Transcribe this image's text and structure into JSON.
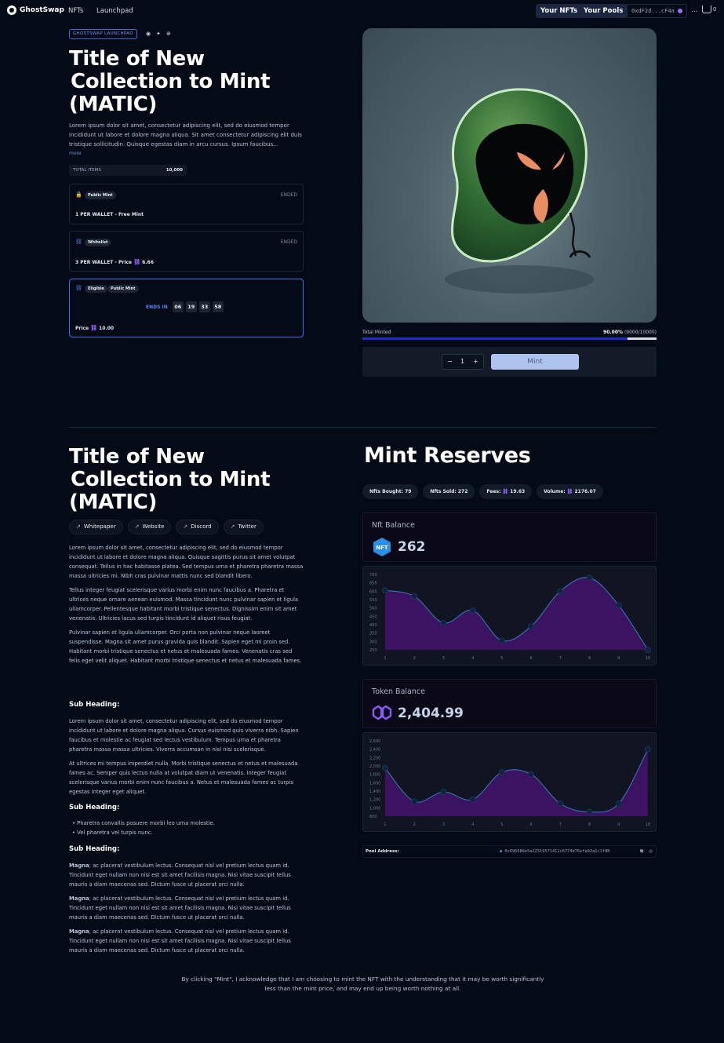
{
  "nav": {
    "brand": "GhostSwap",
    "links": [
      "NFTs",
      "Launchpad"
    ],
    "your_nfts": "Your NFTs",
    "your_pools": "Your Pools",
    "wallet": "0xdF2d...cF4a",
    "more": "...",
    "cart_count": "0"
  },
  "hero": {
    "badge": "GHOSTSWAP LAUNCHPAD",
    "title_lines": [
      "Title of New",
      "Collection to Mint",
      "(MATIC)"
    ],
    "description": "Lorem ipsum dolor sit amet, consectetur adipiscing elit, sed do eiusmod tempor incididunt ut labore et dolore magna aliqua. Sit amet consectetur adipiscing elit duis tristique sollicitudin. Quisque egestas diam in arcu cursus. Ipsum faucibus...",
    "more": "more",
    "total_items_label": "TOTAL ITEMS",
    "total_items_value": "10,000"
  },
  "phases": [
    {
      "tag": "Public Mint",
      "status": "ENDED",
      "text": "1 PER WALLET - Free Mint"
    },
    {
      "tag": "Whitelist",
      "status": "ENDED",
      "text": "3 PER WALLET - Price",
      "price": "6.66"
    },
    {
      "tags": [
        "Eligible",
        "Public Mint"
      ],
      "ends_label": "ENDS IN",
      "timer": [
        "06",
        "19",
        "33",
        "58"
      ],
      "price_label": "Price",
      "price": "10.00"
    }
  ],
  "mint": {
    "total_minted_label": "Total Minted",
    "pct": "90.00%",
    "count": "(9000/10000)",
    "progress": 0.9,
    "minus": "−",
    "qty": "1",
    "plus": "+",
    "button": "Mint"
  },
  "details": {
    "title_lines": [
      "Title of New",
      "Collection to Mint",
      "(MATIC)"
    ],
    "links": [
      "Whitepaper",
      "Website",
      "Discord",
      "Twitter"
    ],
    "p1": "Lorem ipsum dolor sit amet, consectetur adipiscing elit, sed do eiusmod tempor incididunt ut labore et dolore magna aliqua. Quisque sagittis purus sit amet volutpat consequat. Tellus in hac habitasse platea. Sed tempus urna et pharetra pharetra massa massa ultricies mi. Nibh cras pulvinar mattis nunc sed blandit libero.",
    "p2": "Tellus integer feugiat scelerisque varius morbi enim nunc faucibus a. Pharetra et ultrices neque ornare aenean euismod. Massa tincidunt nunc pulvinar sapien et ligula ullamcorper. Pellentesque habitant morbi tristique senectus. Dignissim enim sit amet venenatis. Ultricies lacus sed turpis tincidunt id aliquet risus feugiat.",
    "p3": "Pulvinar sapien et ligula ullamcorper. Orci porta non pulvinar neque laoreet suspendisse. Magna sit amet purus gravida quis blandit. Sapien eget mi proin sed. Habitant morbi tristique senectus et netus et malesuada fames. Venenatis cras sed felis eget velit aliquet. Habitant morbi tristique senectus et netus et malesuada fames.",
    "sub1": "Sub Heading:",
    "p4": "Lorem ipsum dolor sit amet, consectetur adipiscing elit, sed do eiusmod tempor incididunt ut labore et dolore magna aliqua. Cursus euismod quis viverra nibh. Sapien faucibus et molestie ac feugiat sed lectus vestibulum. Tempus urna et pharetra pharetra massa massa ultricies. Viverra accumsan in nisl nisi scelerisque.",
    "p5": "At ultrices mi tempus imperdiet nulla. Morbi tristique senectus et netus et malesuada fames ac. Semper quis lectus nulla at volutpat diam ut venenatis. Integer feugiat scelerisque varius morbi enim nunc faucibus a. Netus et malesuada fames ac turpis egestas integer eget aliquet.",
    "sub2": "Sub Heading:",
    "bullets": [
      "Pharetra convallis posuere morbi leo urna molestie.",
      "Vel pharetra vel turpis nunc."
    ],
    "sub3": "Sub Heading:",
    "magna_bold": "Magna",
    "magna_rest": "; ac placerat vestibulum lectus. Consequat nisl vel pretium lectus quam id. Tincidunt eget nullam non nisi est sit amet facilisis magna. Nisi vitae suscipit tellus mauris a diam maecenas sed. Dictum fusce ut placerat orci nulla."
  },
  "reserves": {
    "title": "Mint Reserves",
    "stats": [
      {
        "label": "Nfts Bought:",
        "value": "79"
      },
      {
        "label": "Nfts Sold:",
        "value": "272"
      },
      {
        "label": "Fees:",
        "value": "19.63"
      },
      {
        "label": "Volume:",
        "value": "2176.07"
      }
    ],
    "nft_balance_label": "Nft Balance",
    "nft_icon_text": "NFT",
    "nft_balance": "262",
    "token_balance_label": "Token Balance",
    "token_balance": "2,404.99",
    "pool_label": "Pool Address:",
    "pool_address": "0x696586e5a22519571411c6774d76efa92a1c1f88"
  },
  "chart_data": [
    {
      "type": "area",
      "x": [
        1,
        2,
        3,
        4,
        5,
        6,
        7,
        8,
        9,
        10
      ],
      "series": [
        {
          "values": [
            605,
            570,
            410,
            485,
            305,
            390,
            600,
            680,
            515,
            250
          ]
        }
      ],
      "ylim": [
        250,
        700
      ],
      "yticks": [
        250,
        300,
        350,
        400,
        450,
        500,
        550,
        600,
        650,
        700
      ],
      "grid": false,
      "colors": {
        "fill": "#3b1360",
        "line": "#2f6fa8",
        "point": "#0e2340"
      }
    },
    {
      "type": "area",
      "x": [
        1,
        2,
        3,
        4,
        5,
        6,
        7,
        8,
        9,
        10
      ],
      "series": [
        {
          "values": [
            1950,
            1150,
            1380,
            1200,
            1850,
            1800,
            1100,
            900,
            1100,
            2400
          ]
        }
      ],
      "ylim": [
        800,
        2600
      ],
      "yticks": [
        800,
        1000,
        1200,
        1400,
        1600,
        1800,
        2000,
        2200,
        2400,
        2600
      ],
      "grid": false,
      "colors": {
        "fill": "#3b1360",
        "line": "#2f6fa8",
        "point": "#0e2340"
      }
    }
  ],
  "disclaimer": "By clicking \"Mint\", I acknowledge that I am choosing to mint the NFT with the understanding that it may be worth significantly less than the mint price, and may end up being worth nothing at all."
}
